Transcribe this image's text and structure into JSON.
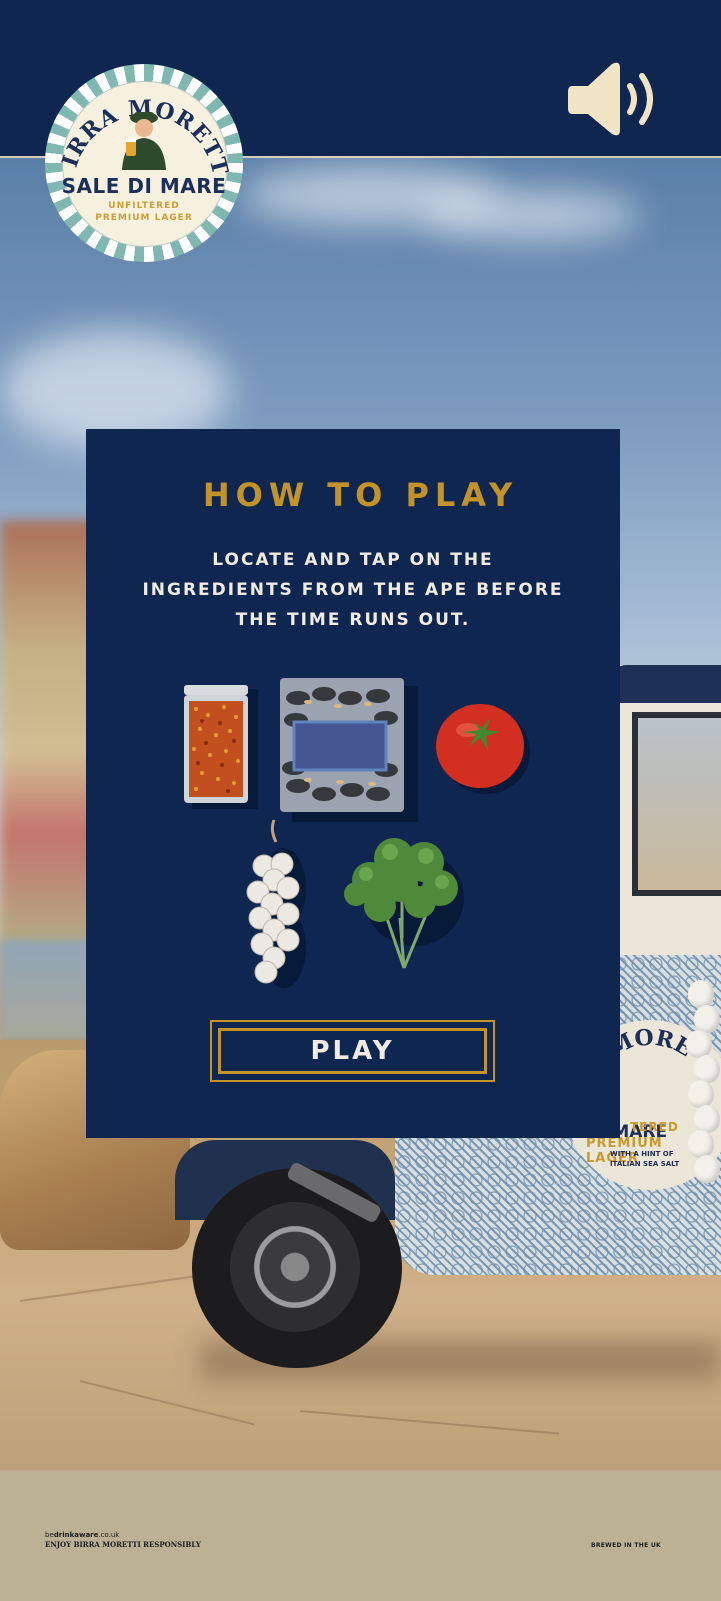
{
  "brand": {
    "arc_text": "BIRRA MORETTI",
    "name": "SALE DI MARE",
    "sub1": "UNFILTERED",
    "sub2": "PREMIUM LAGER"
  },
  "sound_icon": "speaker-icon",
  "modal": {
    "title": "HOW TO PLAY",
    "line1": "LOCATE AND TAP ON THE",
    "line2": "INGREDIENTS FROM THE APE BEFORE",
    "line3": "THE TIME RUNS OUT.",
    "play_label": "PLAY"
  },
  "ingredients": [
    "chili-flakes-jar-icon",
    "mussels-pack-icon",
    "tomato-icon",
    "garlic-string-icon",
    "parsley-icon"
  ],
  "ape_badge": {
    "arc_text": "MORE",
    "name": "DI MARE",
    "sub": "PREMIUM LAGER",
    "note1": "WITH A HINT OF",
    "note2": "ITALIAN SEA SALT",
    "sub_top": "TERED"
  },
  "footer": {
    "drinkaware_pre": "be",
    "drinkaware_bold": "drinkaware",
    "drinkaware_post": ".co.uk",
    "responsibly": "ENJOY BIRRA MORETTI RESPONSIBLY",
    "brewed": "BREWED IN THE UK"
  },
  "colors": {
    "navy": "#0e2650",
    "gold": "#c49326",
    "cream": "#f1ece1"
  }
}
